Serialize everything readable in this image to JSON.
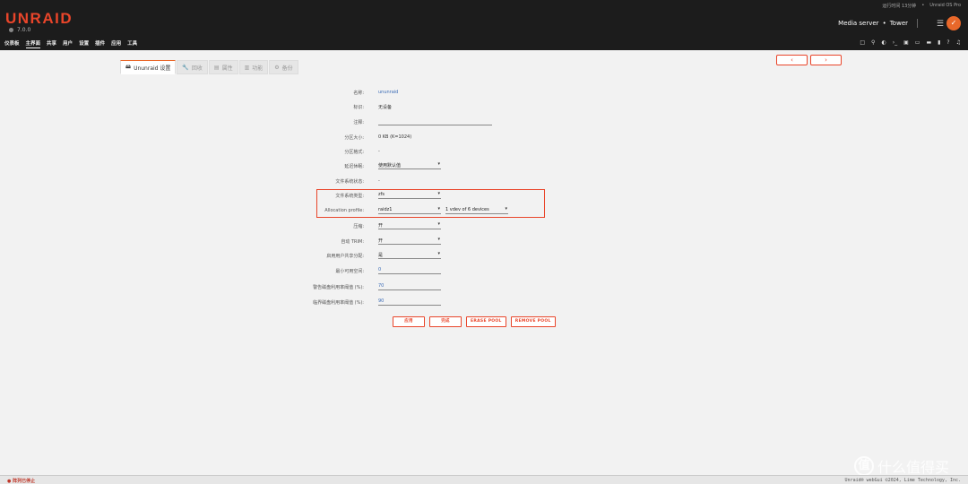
{
  "header": {
    "logo": "UNRAID",
    "version": "7.0.0",
    "uptime": "运行时间 13分钟",
    "edition": "Unraid OS Pro",
    "server_desc": "Media server",
    "server_dot": "•",
    "server_name": "Tower",
    "nav": [
      "仪表板",
      "主界面",
      "共享",
      "用户",
      "设置",
      "插件",
      "应用",
      "工具"
    ],
    "toolicons": [
      "□",
      "⚲",
      "◐",
      "›_",
      "▣",
      "▭",
      "▬",
      "▮",
      "?",
      "♫"
    ]
  },
  "tabs": [
    {
      "icon": "🖴",
      "label": "Ununraid 设置"
    },
    {
      "icon": "🔧",
      "label": "回收"
    },
    {
      "icon": "▤",
      "label": "属性"
    },
    {
      "icon": "▥",
      "label": "功能"
    },
    {
      "icon": "⚙",
      "label": "备份"
    }
  ],
  "nav_buttons": {
    "prev": "‹",
    "next": "›"
  },
  "form": {
    "name_label": "名称:",
    "name_value": "ununraid",
    "id_label": "标识:",
    "id_value": "无设备",
    "comment_label": "注释:",
    "comment_value": "",
    "partsize_label": "分区大小:",
    "partsize_value": "0 KB (K=1024)",
    "partfmt_label": "分区格式:",
    "partfmt_value": "-",
    "spindown_label": "延迟休眠:",
    "spindown_value": "使用默认值",
    "fsstatus_label": "文件系统状态:",
    "fsstatus_value": "-",
    "fstype_label": "文件系统类型:",
    "fstype_value": "zfs",
    "alloc_label": "Allocation profile:",
    "alloc_value": "raidz1",
    "alloc_vdev": "1 vdev of 6 devices",
    "compress_label": "压缩:",
    "compress_value": "开",
    "trim_label": "自动 TRIM:",
    "trim_value": "开",
    "share_label": "启用用户共享分配:",
    "share_value": "是",
    "minfree_label": "最小可用空间:",
    "minfree_value": "0",
    "warn_label": "警告磁盘利用率阈值 (%):",
    "warn_value": "70",
    "crit_label": "临界磁盘利用率阈值 (%):",
    "crit_value": "90"
  },
  "buttons": {
    "apply": "应用",
    "done": "完成",
    "erase": "ERASE POOL",
    "remove": "REMOVE POOL"
  },
  "footer": {
    "status": "阵列已停止",
    "copyright": "Unraid® webGui ©2024, Lime Technology, Inc."
  },
  "watermark": {
    "text": "什么值得买",
    "mark": "值"
  },
  "colors": {
    "accent": "#e9452a",
    "header_bg": "#1c1c1c"
  }
}
